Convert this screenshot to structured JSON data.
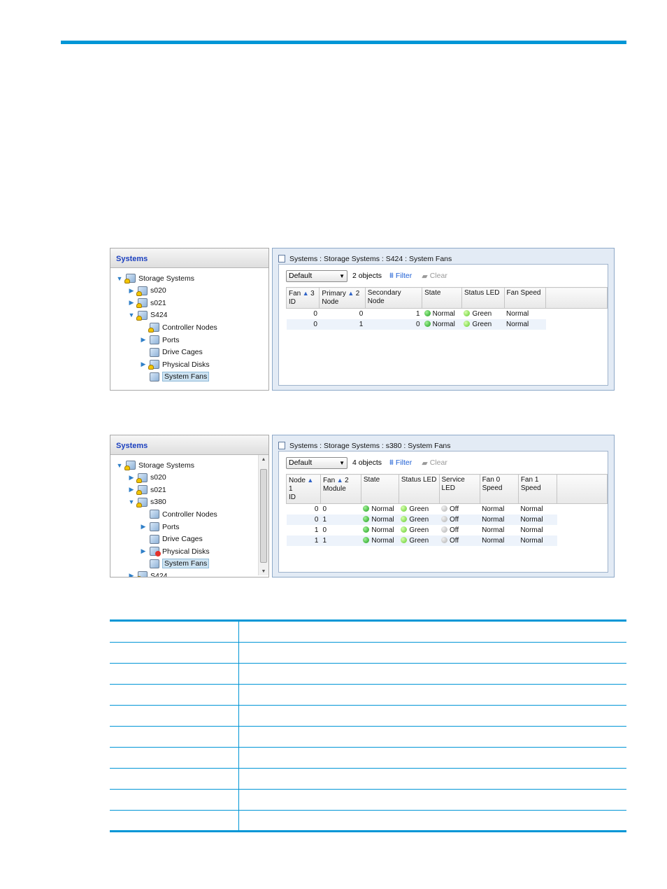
{
  "screen1": {
    "left_header": "Systems",
    "tree": [
      {
        "label": "Storage Systems",
        "expand": "down",
        "icon": "storage-warning-icon",
        "indent": 0
      },
      {
        "label": "s020",
        "expand": "right",
        "icon": "system-warning-icon",
        "indent": 1
      },
      {
        "label": "s021",
        "expand": "right",
        "icon": "system-warning-icon",
        "indent": 1
      },
      {
        "label": "S424",
        "expand": "down",
        "icon": "system-warning-icon",
        "indent": 1
      },
      {
        "label": "Controller Nodes",
        "expand": "",
        "icon": "controller-nodes-warning-icon",
        "indent": 2
      },
      {
        "label": "Ports",
        "expand": "right",
        "icon": "ports-icon",
        "indent": 2
      },
      {
        "label": "Drive Cages",
        "expand": "",
        "icon": "drive-cages-icon",
        "indent": 2
      },
      {
        "label": "Physical Disks",
        "expand": "right",
        "icon": "physical-disks-warning-icon",
        "indent": 2
      },
      {
        "label": "System Fans",
        "expand": "",
        "icon": "system-fans-icon",
        "indent": 2,
        "selected": true
      }
    ],
    "breadcrumb": "Systems : Storage Systems : S424 : System Fans",
    "filter_select": "Default",
    "object_count": "2 objects",
    "filter_label": "Filter",
    "clear_label": "Clear",
    "columns": [
      {
        "l1": "Fan",
        "sort": "3",
        "l2": "ID"
      },
      {
        "l1": "Primary",
        "sort": "2",
        "l2": "Node"
      },
      {
        "l1": "Secondary Node",
        "sort": "",
        "l2": ""
      },
      {
        "l1": "State",
        "sort": "",
        "l2": ""
      },
      {
        "l1": "Status LED",
        "sort": "",
        "l2": ""
      },
      {
        "l1": "Fan Speed",
        "sort": "",
        "l2": ""
      }
    ],
    "rows": [
      [
        "0",
        "0",
        "1",
        "Normal",
        "Green",
        "Normal"
      ],
      [
        "0",
        "1",
        "0",
        "Normal",
        "Green",
        "Normal"
      ]
    ]
  },
  "screen2": {
    "left_header": "Systems",
    "tree": [
      {
        "label": "Storage Systems",
        "expand": "down",
        "icon": "storage-warning-icon",
        "indent": 0
      },
      {
        "label": "s020",
        "expand": "right",
        "icon": "system-warning-icon",
        "indent": 1
      },
      {
        "label": "s021",
        "expand": "right",
        "icon": "system-warning-icon",
        "indent": 1
      },
      {
        "label": "s380",
        "expand": "down",
        "icon": "system-warning-icon",
        "indent": 1
      },
      {
        "label": "Controller Nodes",
        "expand": "",
        "icon": "controller-nodes-icon",
        "indent": 2
      },
      {
        "label": "Ports",
        "expand": "right",
        "icon": "ports-icon",
        "indent": 2
      },
      {
        "label": "Drive Cages",
        "expand": "",
        "icon": "drive-cages-icon",
        "indent": 2
      },
      {
        "label": "Physical Disks",
        "expand": "right",
        "icon": "physical-disks-error-icon",
        "indent": 2
      },
      {
        "label": "System Fans",
        "expand": "",
        "icon": "system-fans-icon",
        "indent": 2,
        "selected": true
      },
      {
        "label": "S424",
        "expand": "right",
        "icon": "system-warning-icon",
        "indent": 1
      }
    ],
    "breadcrumb": "Systems : Storage Systems : s380 : System Fans",
    "filter_select": "Default",
    "object_count": "4 objects",
    "filter_label": "Filter",
    "clear_label": "Clear",
    "columns": [
      {
        "l1": "Node",
        "sort": "1",
        "l2": "ID"
      },
      {
        "l1": "Fan",
        "sort": "2",
        "l2": "Module"
      },
      {
        "l1": "State",
        "sort": "",
        "l2": ""
      },
      {
        "l1": "Status LED",
        "sort": "",
        "l2": ""
      },
      {
        "l1": "Service LED",
        "sort": "",
        "l2": ""
      },
      {
        "l1": "Fan 0",
        "sort": "",
        "l2": "Speed"
      },
      {
        "l1": "Fan 1",
        "sort": "",
        "l2": "Speed"
      }
    ],
    "rows": [
      [
        "0",
        "0",
        "Normal",
        "Green",
        "Off",
        "Normal",
        "Normal"
      ],
      [
        "0",
        "1",
        "Normal",
        "Green",
        "Off",
        "Normal",
        "Normal"
      ],
      [
        "1",
        "0",
        "Normal",
        "Green",
        "Off",
        "Normal",
        "Normal"
      ],
      [
        "1",
        "1",
        "Normal",
        "Green",
        "Off",
        "Normal",
        "Normal"
      ]
    ]
  },
  "colors": {
    "accent_rule": "#0096d6",
    "link_blue": "#1e5fd4",
    "status_green": "#1a9e1a"
  }
}
